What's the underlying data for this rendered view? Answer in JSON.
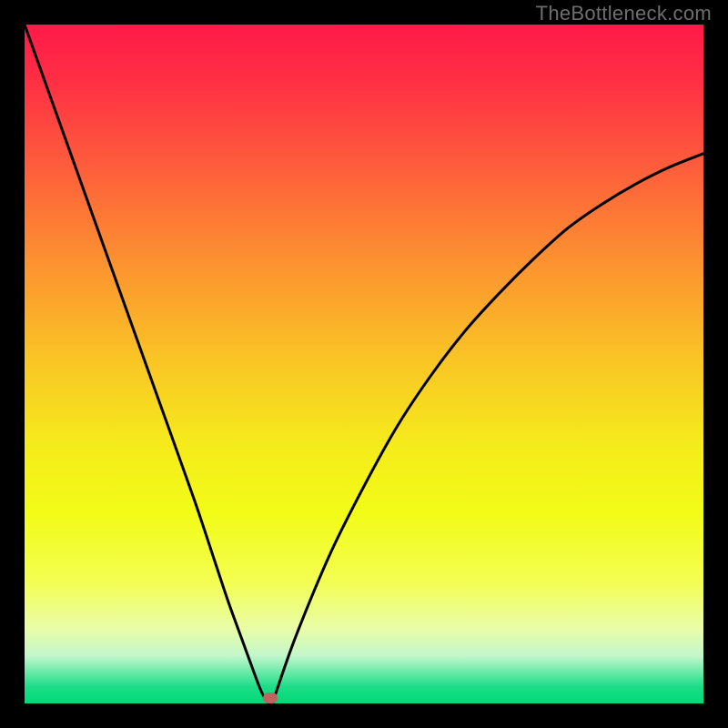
{
  "watermark": "TheBottleneck.com",
  "chart_data": {
    "type": "line",
    "title": "",
    "xlabel": "",
    "ylabel": "",
    "xlim": [
      0,
      100
    ],
    "ylim": [
      0,
      100
    ],
    "grid": false,
    "legend": false,
    "series": [
      {
        "name": "bottleneck-curve",
        "x": [
          0,
          5,
          10,
          15,
          20,
          25,
          28,
          30,
          32,
          34,
          35,
          36,
          36.5,
          37,
          40,
          45,
          50,
          55,
          60,
          65,
          70,
          75,
          80,
          85,
          90,
          95,
          100
        ],
        "y": [
          100,
          86,
          72,
          58,
          44,
          30,
          21,
          15,
          9.5,
          4,
          1.5,
          0,
          0,
          1.5,
          10,
          22,
          32,
          41,
          48.5,
          55,
          60.5,
          65.5,
          70,
          73.5,
          76.5,
          79,
          81
        ]
      }
    ],
    "marker": {
      "name": "optimum-point",
      "x": 36.2,
      "y": 0.8,
      "color": "#BE6560"
    },
    "gradient_stops": [
      {
        "pos": 0.0,
        "color": "#FF1A49"
      },
      {
        "pos": 0.08,
        "color": "#FF2E44"
      },
      {
        "pos": 0.2,
        "color": "#FE5A3C"
      },
      {
        "pos": 0.35,
        "color": "#FC9230"
      },
      {
        "pos": 0.5,
        "color": "#F9C724"
      },
      {
        "pos": 0.62,
        "color": "#F5EB1B"
      },
      {
        "pos": 0.72,
        "color": "#F2FC17"
      },
      {
        "pos": 0.82,
        "color": "#F3FE52"
      },
      {
        "pos": 0.89,
        "color": "#E9FDA8"
      },
      {
        "pos": 0.93,
        "color": "#C2F7CB"
      },
      {
        "pos": 0.955,
        "color": "#66E9A6"
      },
      {
        "pos": 0.975,
        "color": "#1EDD88"
      },
      {
        "pos": 1.0,
        "color": "#00D977"
      }
    ]
  },
  "colors": {
    "frame": "#000000",
    "curve": "#000000",
    "watermark": "#6e6e6e"
  }
}
